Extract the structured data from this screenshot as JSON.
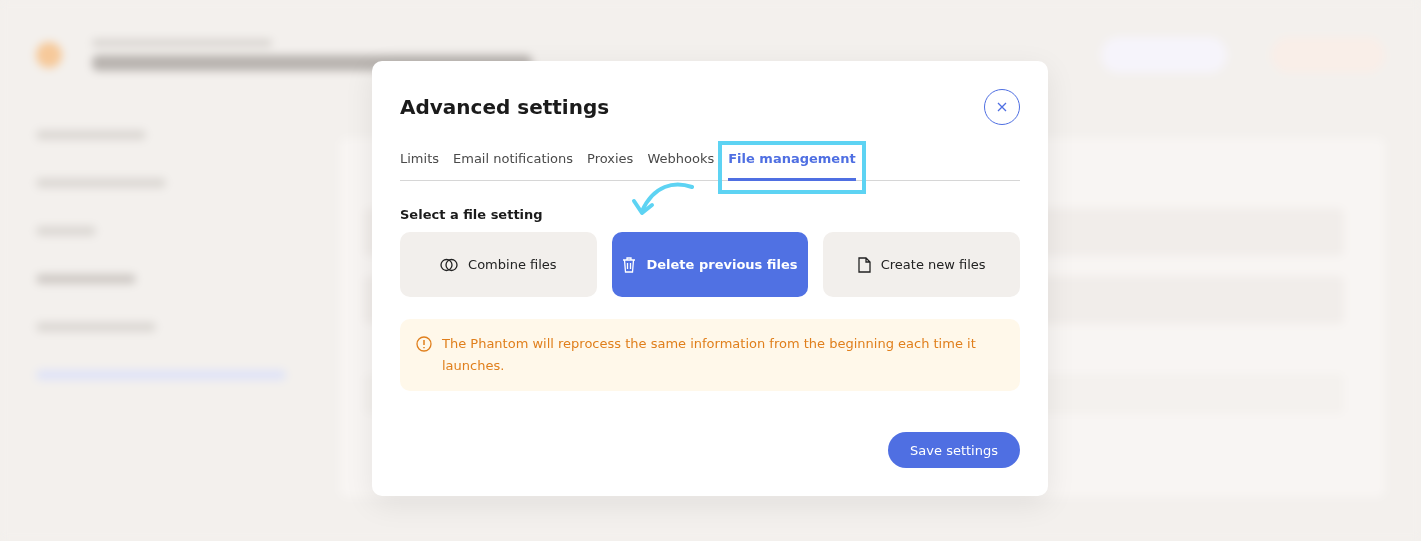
{
  "modal": {
    "title": "Advanced settings",
    "tabs": [
      {
        "label": "Limits",
        "selected": false
      },
      {
        "label": "Email notifications",
        "selected": false
      },
      {
        "label": "Proxies",
        "selected": false
      },
      {
        "label": "Webhooks",
        "selected": false
      },
      {
        "label": "File management",
        "selected": true
      }
    ],
    "section_label": "Select a file setting",
    "options": [
      {
        "kind": "combine",
        "label": "Combine files",
        "selected": false
      },
      {
        "kind": "delete",
        "label": "Delete previous files",
        "selected": true
      },
      {
        "kind": "create",
        "label": "Create new files",
        "selected": false
      }
    ],
    "alert": {
      "text": "The Phantom will reprocess the same information from the beginning each time it launches."
    },
    "save_button": "Save settings"
  }
}
